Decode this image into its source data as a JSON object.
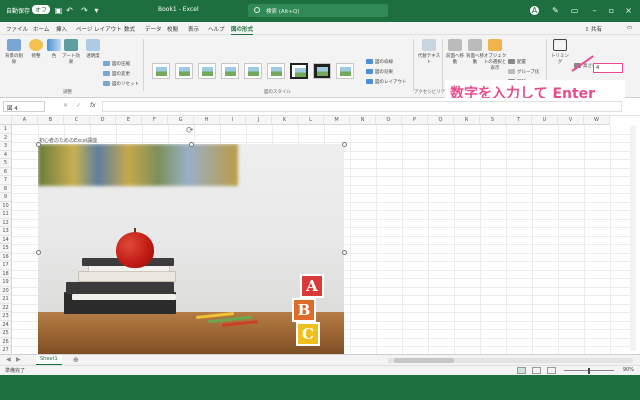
{
  "titlebar": {
    "autosave_label": "自動保存",
    "autosave_state": "オフ",
    "doc_title": "Book1 - Excel",
    "search_placeholder": "検索 (Alt+Q)",
    "user_initial": "A"
  },
  "tabs": [
    "ファイル",
    "ホーム",
    "挿入",
    "ページ レイアウト",
    "数式",
    "データ",
    "校閲",
    "表示",
    "ヘルプ",
    "図の形式"
  ],
  "active_tab": "図の形式",
  "share_label": "共有",
  "comment_label": "",
  "ribbon": {
    "remove_bg": "背景の削除",
    "corrections": "修整",
    "color": "色",
    "artistic_effects": "アート効果",
    "transparency": "透明度",
    "compress": "図の圧縮",
    "change": "図の変更",
    "reset": "図のリセット",
    "adjust_group": "調整",
    "style_group": "図のスタイル",
    "border": "図の枠線",
    "effects": "図の効果",
    "layout": "図のレイアウト",
    "alt_text": "代替テキスト",
    "accessibility_group": "アクセシビリティ",
    "bring_forward": "前面へ移動",
    "send_backward": "背面へ移動",
    "selection_pane": "オブジェクトの選択と表示",
    "align": "配置",
    "group": "グループ化",
    "rotate": "回転",
    "crop": "トリミング",
    "height_label": "高さ:",
    "height_value": "4"
  },
  "callout": "数字を入力して Enter",
  "formulabar": {
    "namebox": "図 4",
    "fx": "fx"
  },
  "grid": {
    "columns": [
      "A",
      "B",
      "C",
      "D",
      "E",
      "F",
      "G",
      "H",
      "I",
      "J",
      "K",
      "L",
      "M",
      "N",
      "O",
      "P",
      "Q",
      "R",
      "S",
      "T",
      "U",
      "V",
      "W"
    ],
    "rows": [
      "1",
      "2",
      "3",
      "4",
      "5",
      "6",
      "7",
      "8",
      "9",
      "10",
      "11",
      "12",
      "13",
      "14",
      "15",
      "16",
      "17",
      "18",
      "19",
      "20",
      "21",
      "22",
      "23",
      "24",
      "25",
      "26",
      "27"
    ],
    "cell_b2": "初心者のためのExcel講座"
  },
  "picture": {
    "blocks": [
      "A",
      "B",
      "C"
    ]
  },
  "sheet_tab": "Sheet1",
  "status": "準備完了",
  "zoom": "90%"
}
